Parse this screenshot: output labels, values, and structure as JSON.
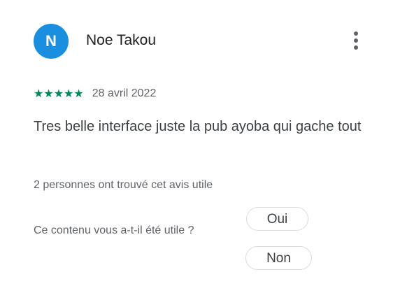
{
  "review": {
    "avatar_initial": "N",
    "author": "Noe Takou",
    "rating": 5,
    "rating_max": 5,
    "stars": "★★★★★",
    "date": "28 avril 2022",
    "text": "Tres belle interface juste la pub ayoba qui gache tout",
    "helpful_count_text": "2 personnes ont trouvé cet avis utile"
  },
  "feedback": {
    "question": "Ce contenu vous a-t-il été utile ?",
    "yes_label": "Oui",
    "no_label": "Non"
  },
  "icons": {
    "more": "more-vert-icon",
    "star": "star-icon"
  },
  "colors": {
    "avatar_bg": "#1a8fe0",
    "star": "#01875f",
    "secondary_text": "#5f6368",
    "primary_text": "#202124",
    "pill_border": "#dadce0"
  }
}
